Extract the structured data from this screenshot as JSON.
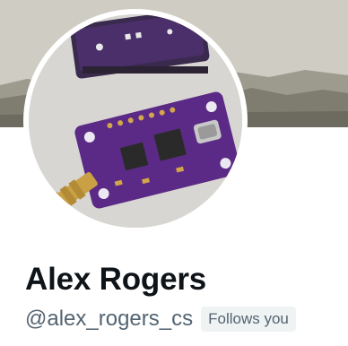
{
  "profile": {
    "display_name": "Alex Rogers",
    "handle": "@alex_rogers_cs",
    "follows_badge": "Follows you"
  },
  "banner": {
    "description_icon": "landscape-photo"
  },
  "avatar": {
    "icon": "purple-pcb-board-photo",
    "colors": {
      "pcb": "#5b2a86",
      "pad_gold": "#d4a64a",
      "usb": "#c8c8c8"
    }
  }
}
